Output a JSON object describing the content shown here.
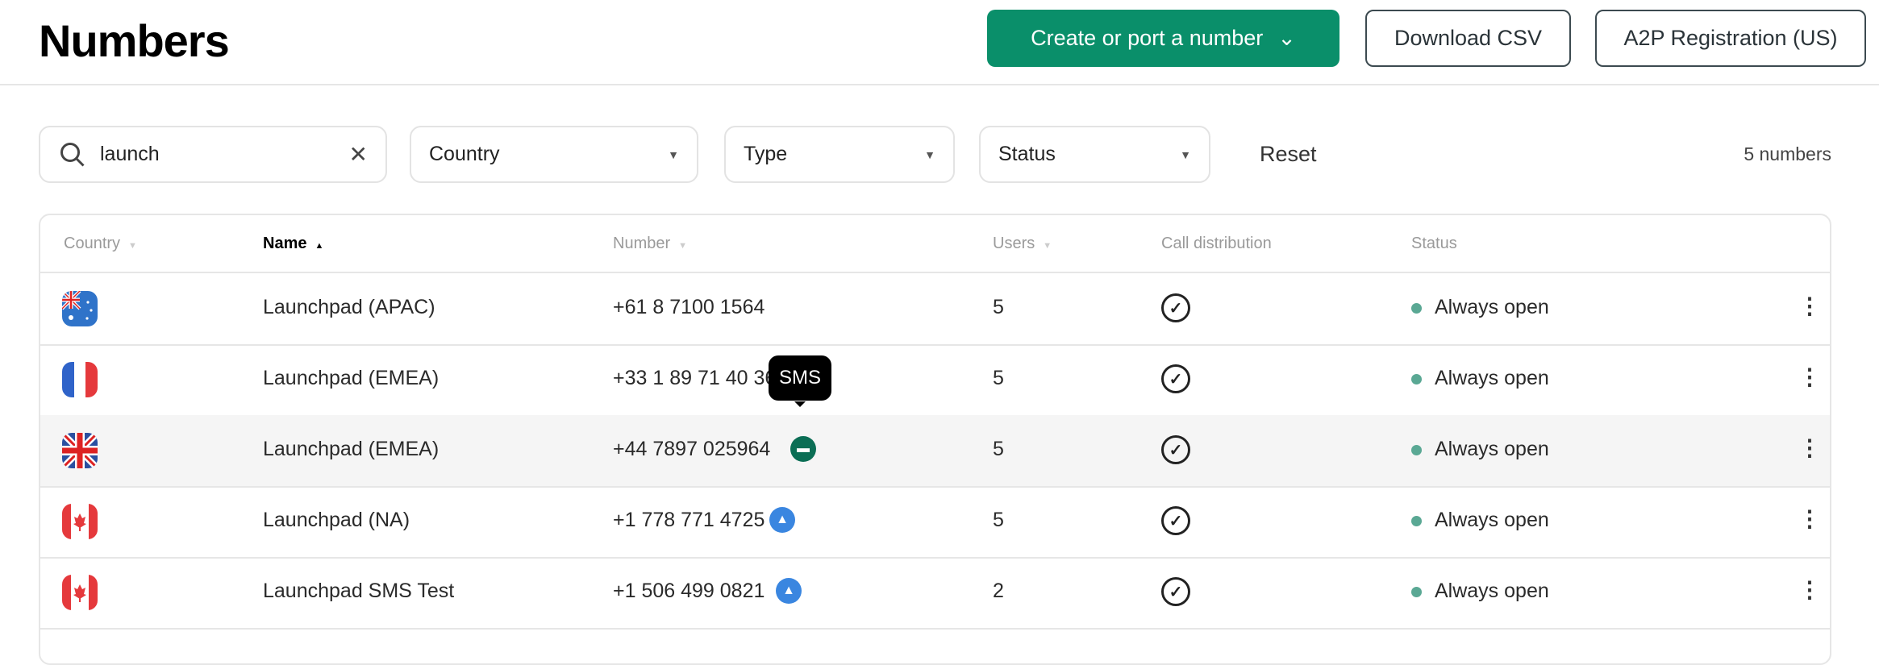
{
  "header": {
    "title": "Numbers",
    "create_label": "Create or port a number",
    "download_label": "Download CSV",
    "a2p_label": "A2P Registration (US)"
  },
  "filters": {
    "search_value": "launch",
    "country": "Country",
    "type": "Type",
    "status": "Status",
    "reset": "Reset",
    "count": "5 numbers"
  },
  "table": {
    "columns": [
      "Country",
      "Name",
      "Number",
      "Users",
      "Call distribution",
      "Status"
    ],
    "sort": {
      "column": "Name",
      "direction": "ascending"
    },
    "rows": [
      {
        "country": "Australia",
        "name": "Launchpad (APAC)",
        "number": "+61 8 7100 1564",
        "users": "5",
        "status": "Always open",
        "msg": ""
      },
      {
        "country": "France",
        "name": "Launchpad (EMEA)",
        "number": "+33 1 89 71 40 36",
        "users": "5",
        "status": "Always open",
        "msg": ""
      },
      {
        "country": "United Kingdom",
        "name": "Launchpad (EMEA)",
        "number": "+44 7897 025964",
        "users": "5",
        "status": "Always open",
        "msg": "sms"
      },
      {
        "country": "Canada",
        "name": "Launchpad (NA)",
        "number": "+1 778 771 4725",
        "users": "5",
        "status": "Always open",
        "msg": "mms"
      },
      {
        "country": "Canada",
        "name": "Launchpad SMS Test",
        "number": "+1 506 499 0821",
        "users": "2",
        "status": "Always open",
        "msg": "mms"
      }
    ]
  },
  "tooltip": "SMS",
  "colors": {
    "primary": "#0a8f6a",
    "status_dot": "#5aa894",
    "sms": "#0b6e55",
    "mms": "#3a86e0"
  }
}
